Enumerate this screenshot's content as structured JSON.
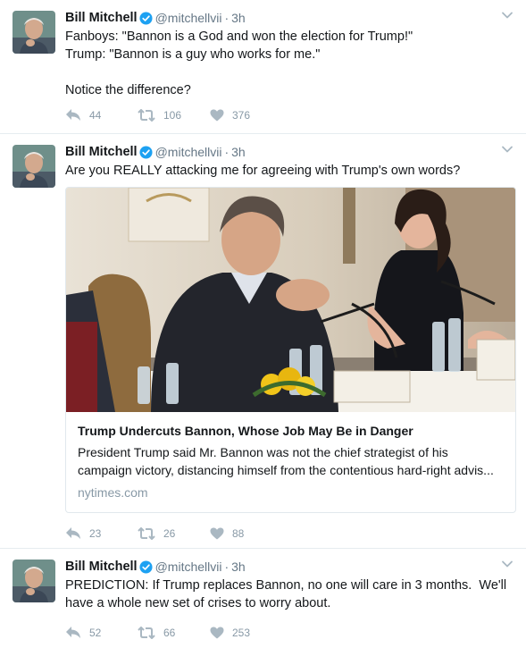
{
  "tweets": [
    {
      "author_name": "Bill Mitchell",
      "handle": "@mitchellvii",
      "dot": "·",
      "time": "3h",
      "lines": [
        "Fanboys: \"Bannon is a God and won the election for Trump!\"",
        "Trump: \"Bannon is a guy who works for me.\"",
        "",
        "Notice the difference?"
      ],
      "replies": "44",
      "retweets": "106",
      "likes": "376"
    },
    {
      "author_name": "Bill Mitchell",
      "handle": "@mitchellvii",
      "dot": "·",
      "time": "3h",
      "lines": [
        "Are you REALLY attacking me for agreeing with Trump's own words?"
      ],
      "card": {
        "title": "Trump Undercuts Bannon, Whose Job May Be in Danger",
        "description_line1": "President Trump said Mr. Bannon was not the chief strategist of his",
        "description_line2": "campaign victory, distancing himself from the contentious hard-right advis...",
        "domain": "nytimes.com"
      },
      "replies": "23",
      "retweets": "26",
      "likes": "88"
    },
    {
      "author_name": "Bill Mitchell",
      "handle": "@mitchellvii",
      "dot": "·",
      "time": "3h",
      "lines": [
        "PREDICTION: If Trump replaces Bannon, no one will care in 3 months.  We'll",
        "have a whole new set of crises to worry about."
      ],
      "replies": "52",
      "retweets": "66",
      "likes": "253"
    }
  ],
  "icons": {
    "verified": "verified-badge-icon",
    "reply": "reply-arrow-icon",
    "retweet": "retweet-arrows-icon",
    "like": "heart-icon",
    "more": "chevron-down-icon"
  },
  "colors": {
    "verified": "#1da1f2",
    "icon_gray": "#aab8c2",
    "meta_gray": "#657786",
    "divider": "#e6ecf0"
  }
}
